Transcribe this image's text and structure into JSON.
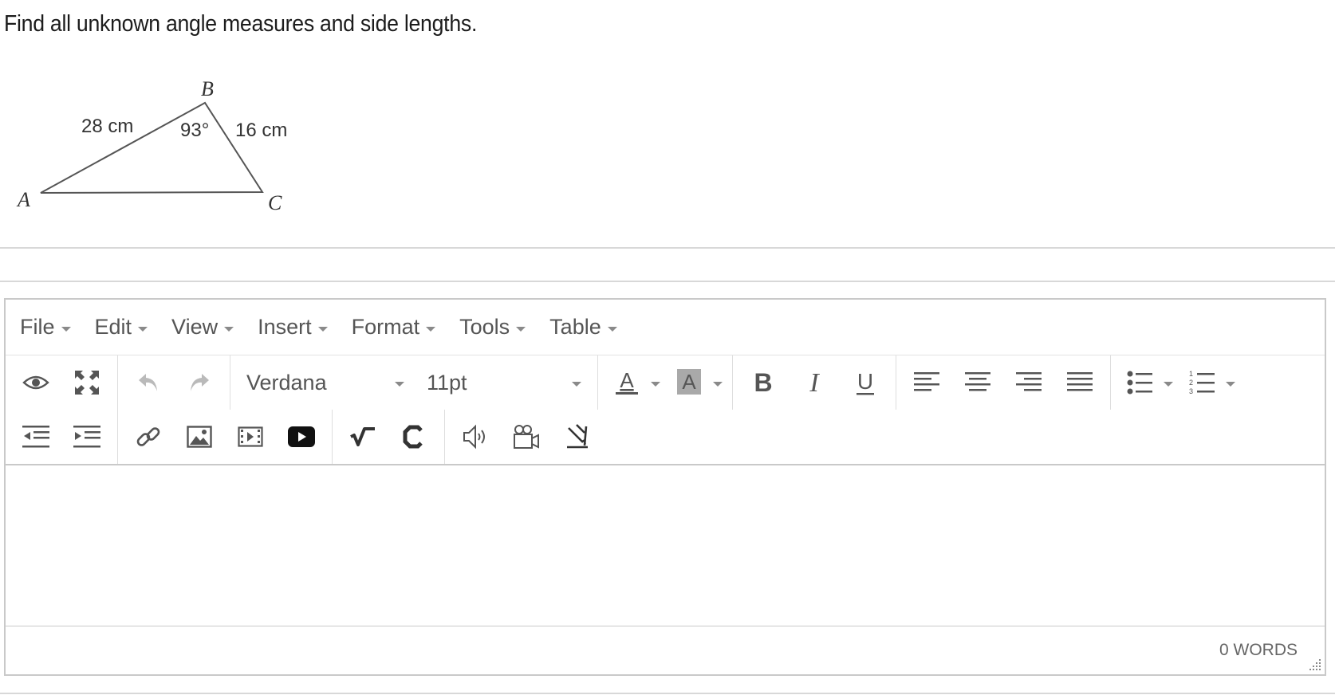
{
  "question": {
    "text": "Find all unknown angle measures and side lengths."
  },
  "figure": {
    "vertices": {
      "a": "A",
      "b": "B",
      "c": "C"
    },
    "side_ab": "28 cm",
    "side_bc": "16 cm",
    "angle_b": "93°"
  },
  "editor": {
    "menubar": {
      "items": [
        "File",
        "Edit",
        "View",
        "Insert",
        "Format",
        "Tools",
        "Table"
      ]
    },
    "toolbar": {
      "font_family": "Verdana",
      "font_size": "11pt",
      "text_color_glyph": "A",
      "bg_color_glyph": "A",
      "bold_glyph": "B",
      "italic_glyph": "I",
      "underline_glyph": "U",
      "icons": [
        "preview-icon",
        "fullscreen-icon",
        "undo-icon",
        "redo-icon",
        "text-color-icon",
        "background-color-icon",
        "bold-icon",
        "italic-icon",
        "underline-icon",
        "align-left-icon",
        "align-center-icon",
        "align-right-icon",
        "align-justify-icon",
        "bullet-list-icon",
        "numbered-list-icon",
        "outdent-icon",
        "indent-icon",
        "link-icon",
        "image-icon",
        "media-icon",
        "youtube-icon",
        "equation-icon",
        "chemistry-icon",
        "audio-icon",
        "video-record-icon",
        "draw-icon"
      ]
    },
    "statusbar": {
      "word_count": "0 WORDS"
    },
    "colors": {
      "border": "#c9c9c9",
      "icon": "#555555",
      "separator": "#dedede"
    }
  }
}
